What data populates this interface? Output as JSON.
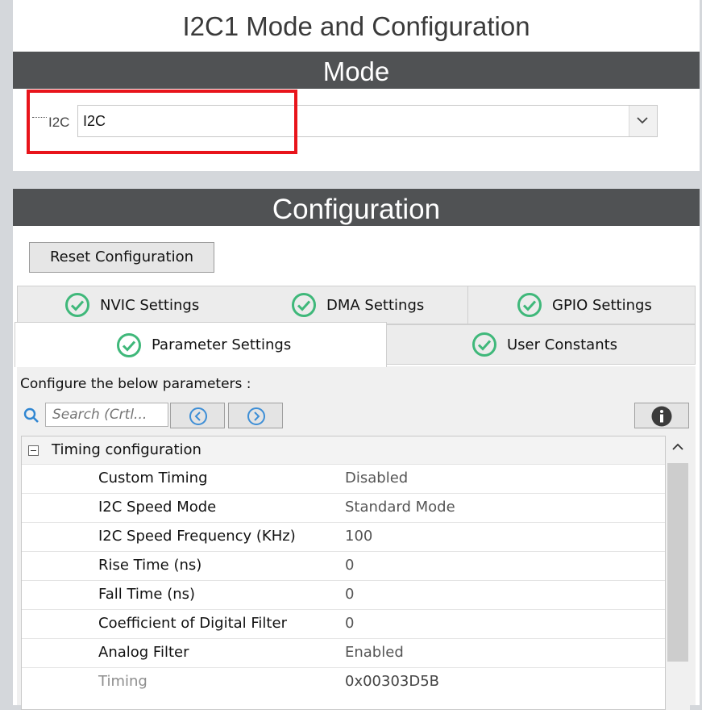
{
  "window": {
    "title": "I2C1 Mode and Configuration"
  },
  "mode_section": {
    "header": "Mode",
    "field_label": "I2C",
    "selected_value": "I2C",
    "highlight_color": "#e8141b"
  },
  "config_section": {
    "header": "Configuration",
    "reset_button": "Reset Configuration"
  },
  "tabs": [
    {
      "label": "NVIC Settings",
      "icon": "check-circle-icon",
      "active": false
    },
    {
      "label": "DMA Settings",
      "icon": "check-circle-icon",
      "active": false
    },
    {
      "label": "GPIO Settings",
      "icon": "check-circle-icon",
      "active": false
    },
    {
      "label": "Parameter Settings",
      "icon": "check-circle-icon",
      "active": true
    },
    {
      "label": "User Constants",
      "icon": "check-circle-icon",
      "active": false
    }
  ],
  "parameters": {
    "instruction": "Configure the below parameters :",
    "search_placeholder": "Search (Crtl...",
    "group": {
      "label": "Timing configuration",
      "expanded": true
    },
    "rows": [
      {
        "name": "Custom Timing",
        "value": "Disabled"
      },
      {
        "name": "I2C Speed Mode",
        "value": "Standard Mode"
      },
      {
        "name": "I2C Speed Frequency (KHz)",
        "value": "100"
      },
      {
        "name": "Rise Time (ns)",
        "value": "0"
      },
      {
        "name": "Fall Time (ns)",
        "value": "0"
      },
      {
        "name": "Coefficient of Digital Filter",
        "value": "0"
      },
      {
        "name": "Analog Filter",
        "value": "Enabled"
      },
      {
        "name": "Timing",
        "value": "0x00303D5B",
        "disabled": true
      }
    ]
  },
  "colors": {
    "header_bar": "#505254",
    "check_icon": "#3fb87a",
    "nav_icon": "#3d8ed6",
    "background": "#d4d7db"
  }
}
